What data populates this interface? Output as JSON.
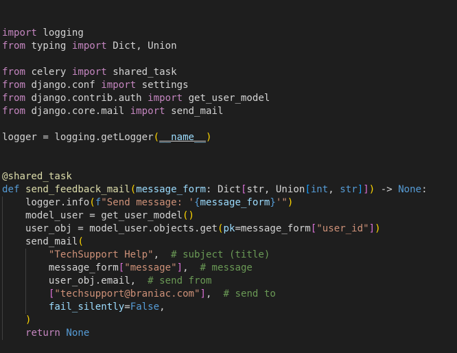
{
  "editor": {
    "language": "python",
    "lines": [
      [
        [
          "kw",
          "import"
        ],
        [
          "plain",
          " logging"
        ]
      ],
      [
        [
          "kw",
          "from"
        ],
        [
          "plain",
          " typing "
        ],
        [
          "kw",
          "import"
        ],
        [
          "plain",
          " Dict, Union"
        ]
      ],
      [],
      [
        [
          "kw",
          "from"
        ],
        [
          "plain",
          " celery "
        ],
        [
          "kw",
          "import"
        ],
        [
          "plain",
          " shared_task"
        ]
      ],
      [
        [
          "kw",
          "from"
        ],
        [
          "plain",
          " django.conf "
        ],
        [
          "kw",
          "import"
        ],
        [
          "plain",
          " settings"
        ]
      ],
      [
        [
          "kw",
          "from"
        ],
        [
          "plain",
          " django.contrib.auth "
        ],
        [
          "kw",
          "import"
        ],
        [
          "plain",
          " get_user_model"
        ]
      ],
      [
        [
          "kw",
          "from"
        ],
        [
          "plain",
          " django.core.mail "
        ],
        [
          "kw",
          "import"
        ],
        [
          "plain",
          " send_mail"
        ]
      ],
      [],
      [
        [
          "plain",
          "logger = logging.getLogger"
        ],
        [
          "br1",
          "("
        ],
        [
          "dunder",
          "__name__"
        ],
        [
          "br1",
          ")"
        ]
      ],
      [],
      [],
      [
        [
          "dec",
          "@shared_task"
        ]
      ],
      [
        [
          "def",
          "def"
        ],
        [
          "plain",
          " "
        ],
        [
          "fn",
          "send_feedback_mail"
        ],
        [
          "br1",
          "("
        ],
        [
          "var",
          "message_form"
        ],
        [
          "plain",
          ": Dict"
        ],
        [
          "br2",
          "["
        ],
        [
          "plain",
          "str, Union"
        ],
        [
          "br3",
          "["
        ],
        [
          "def",
          "int"
        ],
        [
          "plain",
          ", "
        ],
        [
          "def",
          "str"
        ],
        [
          "br3",
          "]"
        ],
        [
          "br2",
          "]"
        ],
        [
          "br1",
          ")"
        ],
        [
          "plain",
          " -> "
        ],
        [
          "const",
          "None"
        ],
        [
          "plain",
          ":"
        ]
      ],
      [
        [
          "plain",
          "    logger.info"
        ],
        [
          "br1",
          "("
        ],
        [
          "def",
          "f"
        ],
        [
          "str",
          "\"Send message: '"
        ],
        [
          "def",
          "{"
        ],
        [
          "var",
          "message_form"
        ],
        [
          "def",
          "}"
        ],
        [
          "str",
          "'\""
        ],
        [
          "br1",
          ")"
        ]
      ],
      [
        [
          "plain",
          "    model_user = get_user_model"
        ],
        [
          "br1",
          "()"
        ]
      ],
      [
        [
          "plain",
          "    user_obj = model_user.objects.get"
        ],
        [
          "br1",
          "("
        ],
        [
          "var",
          "pk"
        ],
        [
          "plain",
          "=message_form"
        ],
        [
          "br2",
          "["
        ],
        [
          "str",
          "\"user_id\""
        ],
        [
          "br2",
          "]"
        ],
        [
          "br1",
          ")"
        ]
      ],
      [
        [
          "plain",
          "    send_mail"
        ],
        [
          "br1",
          "("
        ]
      ],
      [
        [
          "plain",
          "        "
        ],
        [
          "str",
          "\"TechSupport Help\""
        ],
        [
          "plain",
          ",  "
        ],
        [
          "com",
          "# subject (title)"
        ]
      ],
      [
        [
          "plain",
          "        message_form"
        ],
        [
          "br2",
          "["
        ],
        [
          "str",
          "\"message\""
        ],
        [
          "br2",
          "]"
        ],
        [
          "plain",
          ",  "
        ],
        [
          "com",
          "# message"
        ]
      ],
      [
        [
          "plain",
          "        user_obj.email,  "
        ],
        [
          "com",
          "# send from"
        ]
      ],
      [
        [
          "plain",
          "        "
        ],
        [
          "br2",
          "["
        ],
        [
          "str",
          "\"techsupport@braniac.com\""
        ],
        [
          "br2",
          "]"
        ],
        [
          "plain",
          ",  "
        ],
        [
          "com",
          "# send to"
        ]
      ],
      [
        [
          "plain",
          "        "
        ],
        [
          "var",
          "fail_silently"
        ],
        [
          "plain",
          "="
        ],
        [
          "const",
          "False"
        ],
        [
          "plain",
          ","
        ]
      ],
      [
        [
          "plain",
          "    "
        ],
        [
          "br1",
          ")"
        ]
      ],
      [
        [
          "plain",
          "    "
        ],
        [
          "kw",
          "return"
        ],
        [
          "plain",
          " "
        ],
        [
          "const",
          "None"
        ]
      ]
    ]
  }
}
